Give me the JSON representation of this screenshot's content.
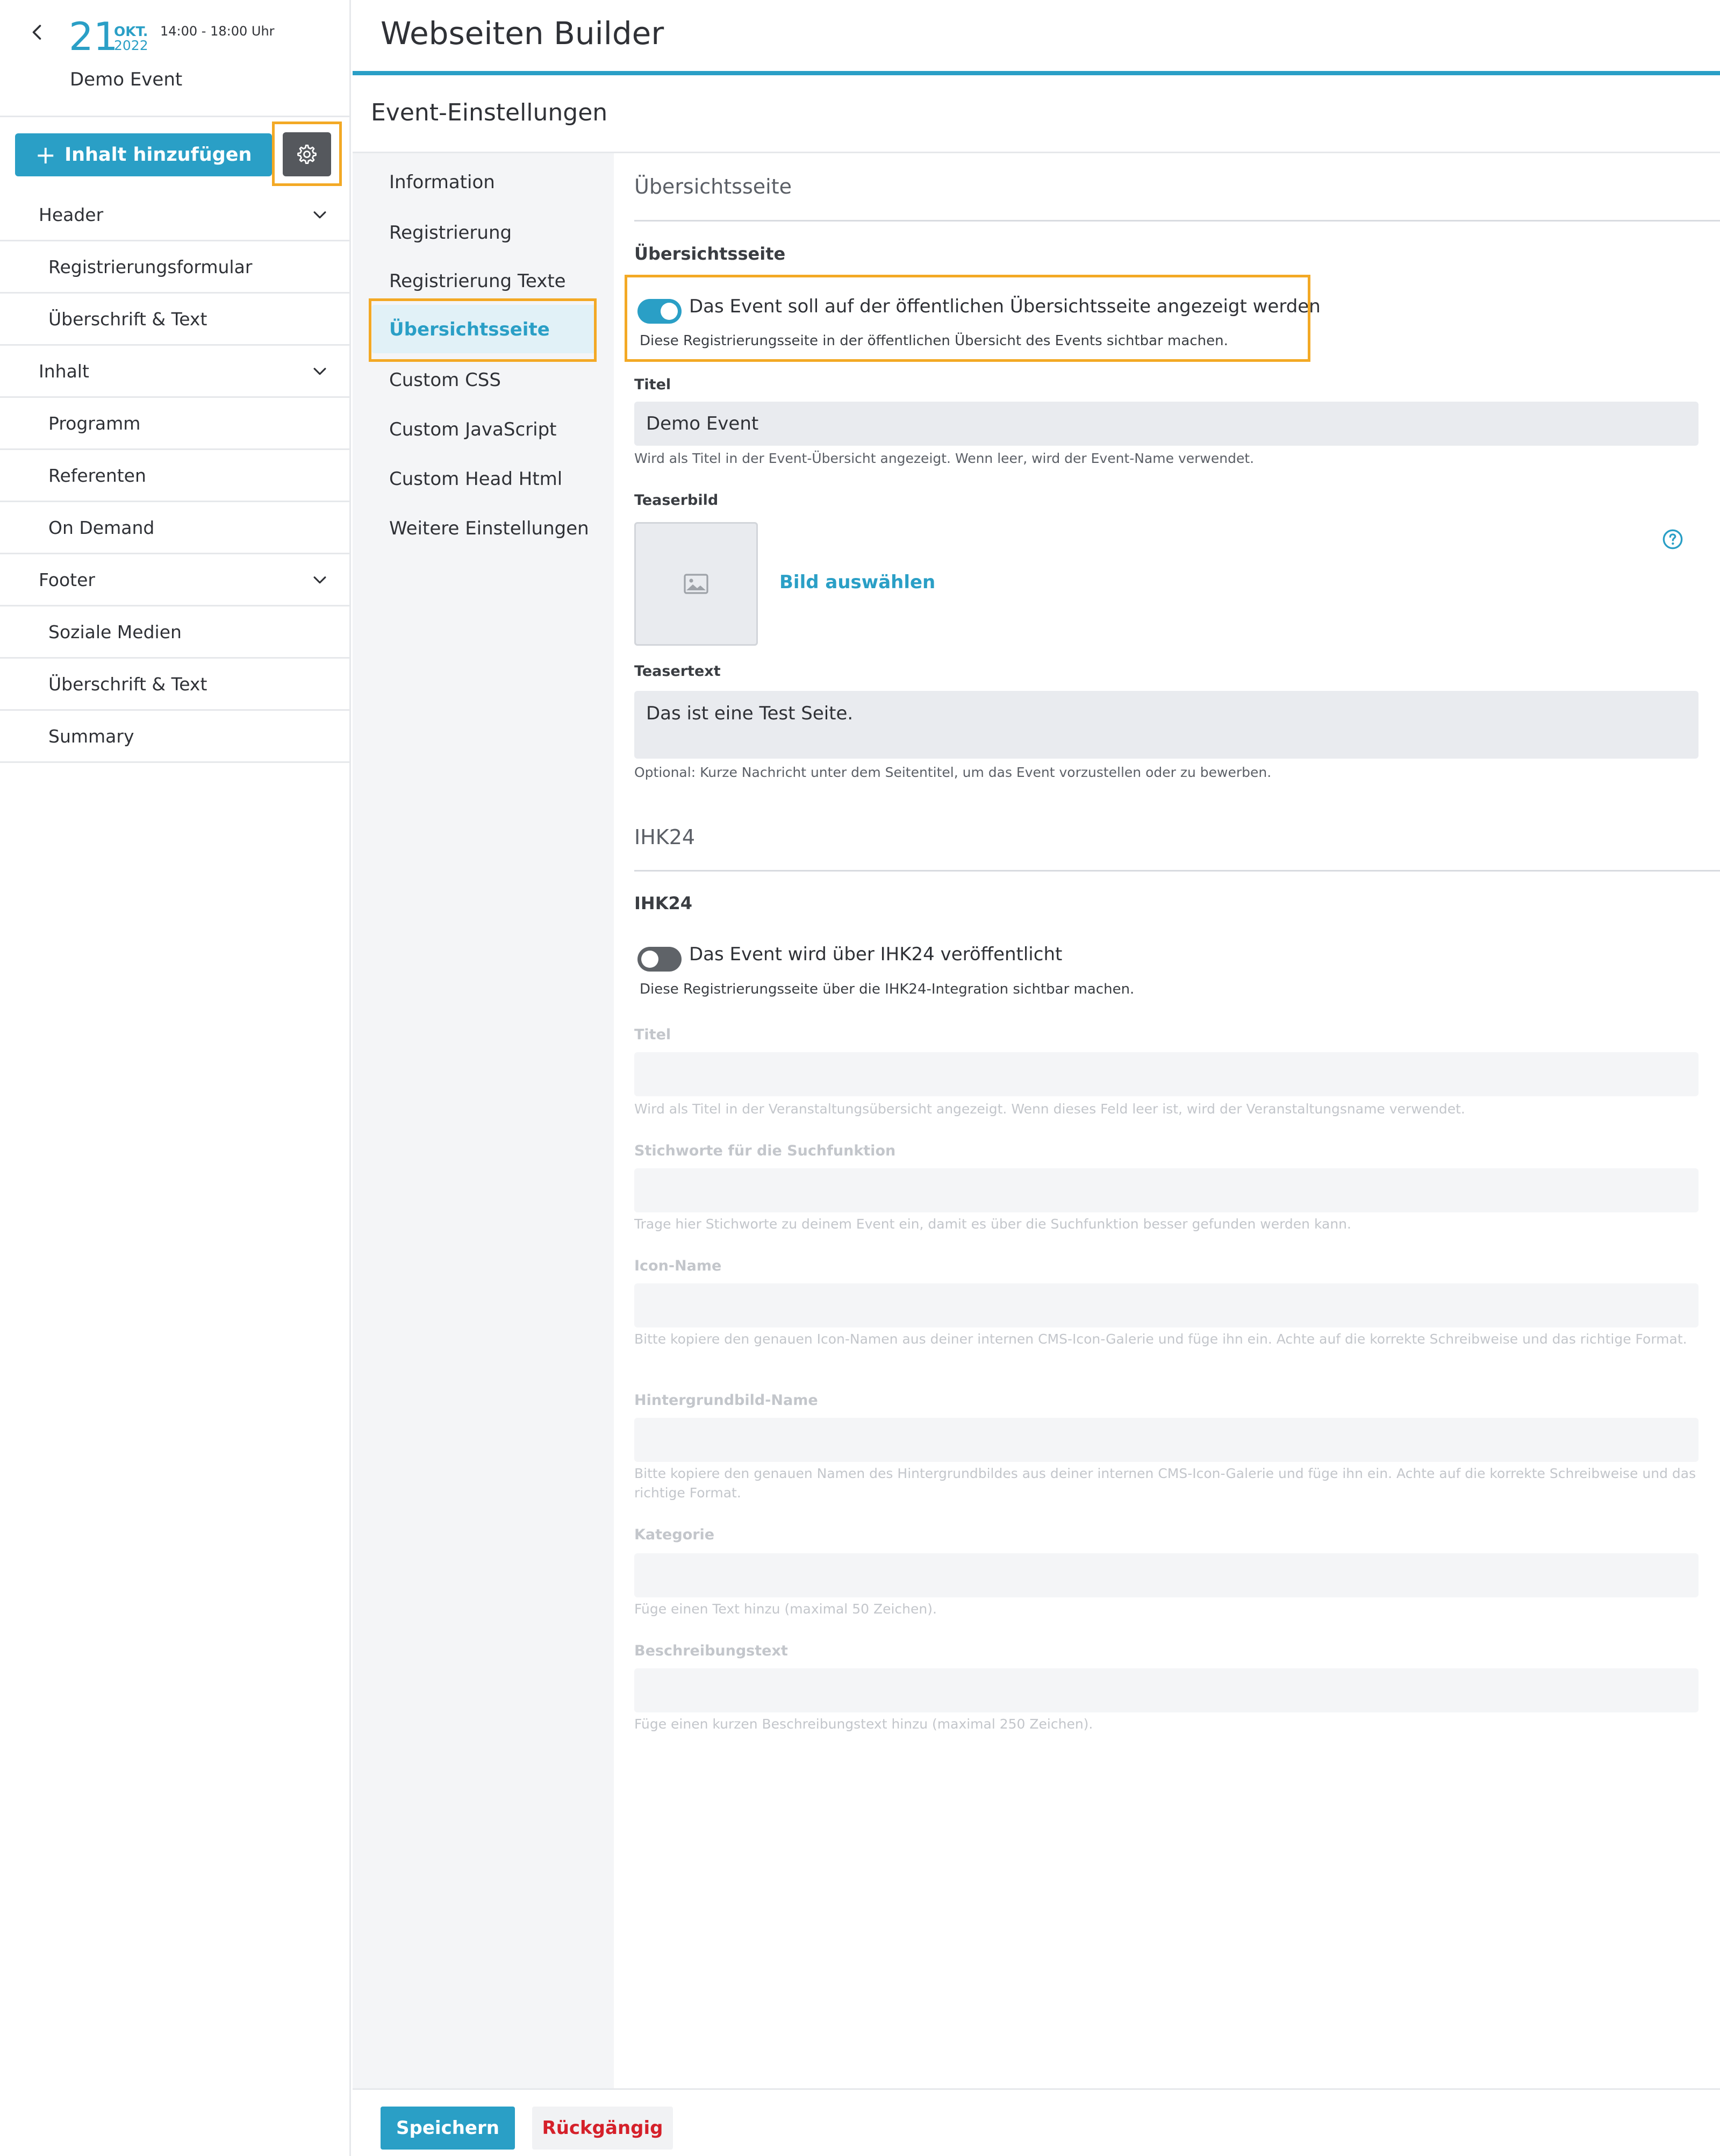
{
  "event": {
    "day": "21",
    "month": "OKT.",
    "year": "2022",
    "time": "14:00 - 18:00 Uhr",
    "name": "Demo Event"
  },
  "sidebar": {
    "add_label": "Inhalt hinzufügen",
    "groups": [
      {
        "label": "Header",
        "items": [
          "Registrierungsformular",
          "Überschrift & Text"
        ]
      },
      {
        "label": "Inhalt",
        "items": [
          "Programm",
          "Referenten",
          "On Demand"
        ]
      },
      {
        "label": "Footer",
        "items": [
          "Soziale Medien",
          "Überschrift & Text",
          "Summary"
        ]
      }
    ]
  },
  "header": {
    "title": "Webseiten Builder",
    "section": "Event-Einstellungen"
  },
  "menu": {
    "items": [
      "Information",
      "Registrierung",
      "Registrierung Texte",
      "Übersichtsseite",
      "Custom CSS",
      "Custom JavaScript",
      "Custom Head Html",
      "Weitere Einstellungen"
    ],
    "active_index": 3
  },
  "overview": {
    "section_title": "Übersichtsseite",
    "sub_title": "Übersichtsseite",
    "toggle_label": "Das Event soll auf der öffentlichen Übersichtsseite angezeigt werden",
    "toggle_hint": "Diese Registrierungsseite in der öffentlichen Übersicht des Events sichtbar machen.",
    "toggle_on": true,
    "title_label": "Titel",
    "title_value": "Demo Event",
    "title_hint": "Wird als Titel in der Event-Übersicht angezeigt. Wenn leer, wird der Event-Name verwendet.",
    "image_label": "Teaserbild",
    "image_link": "Bild auswählen",
    "teaser_label": "Teasertext",
    "teaser_value": "Das ist eine Test Seite.",
    "teaser_hint": "Optional: Kurze Nachricht unter dem Seitentitel, um das Event vorzustellen oder zu bewerben."
  },
  "ihk": {
    "section_title": "IHK24",
    "sub_title": "IHK24",
    "toggle_label": "Das Event wird über IHK24 veröffentlicht",
    "toggle_hint": "Diese Registrierungsseite über die IHK24-Integration sichtbar machen.",
    "toggle_on": false,
    "fields": [
      {
        "label": "Titel",
        "hint": "Wird als Titel in der Veranstaltungsübersicht angezeigt. Wenn dieses Feld leer ist, wird der Veranstaltungsname verwendet."
      },
      {
        "label": "Stichworte für die Suchfunktion",
        "hint": "Trage hier Stichworte zu deinem Event ein, damit es über die Suchfunktion besser gefunden werden kann."
      },
      {
        "label": "Icon-Name",
        "hint": "Bitte kopiere den genauen Icon-Namen aus deiner internen CMS-Icon-Galerie und füge ihn ein. Achte auf die korrekte Schreibweise und das richtige Format."
      },
      {
        "label": "Hintergrundbild-Name",
        "hint": "Bitte kopiere den genauen Namen des Hintergrundbildes aus deiner internen CMS-Icon-Galerie und füge ihn ein. Achte auf die korrekte Schreibweise und das richtige Format."
      },
      {
        "label": "Kategorie",
        "hint": "Füge einen Text hinzu (maximal 50 Zeichen)."
      },
      {
        "label": "Beschreibungstext",
        "hint": "Füge einen kurzen Beschreibungstext hinzu (maximal 250 Zeichen)."
      }
    ]
  },
  "footer": {
    "save_label": "Speichern",
    "undo_label": "Rückgängig"
  },
  "colors": {
    "accent": "#2a9fc6",
    "highlight": "#f3a925",
    "danger": "#d5202a"
  }
}
